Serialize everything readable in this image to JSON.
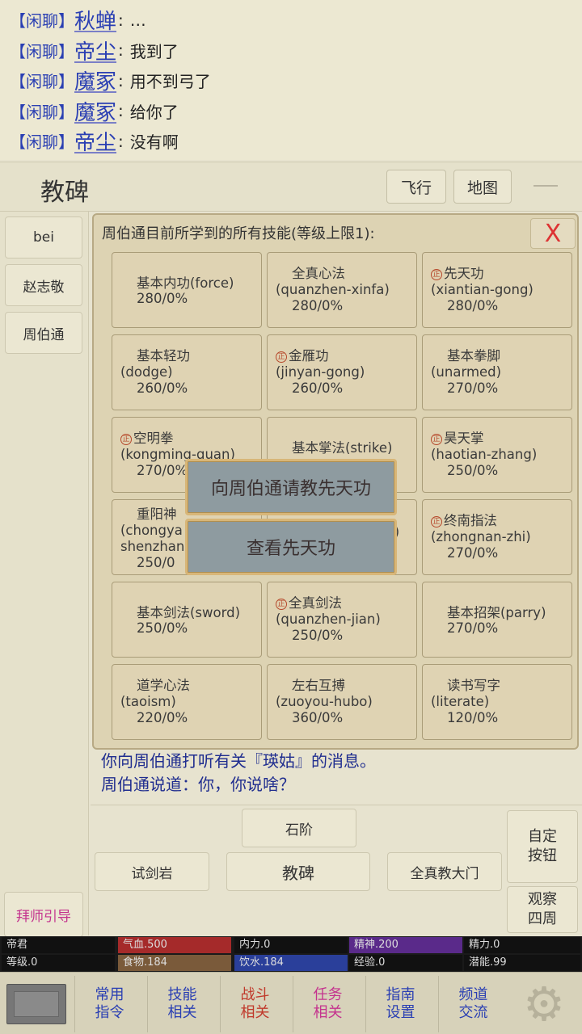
{
  "chat": {
    "lines": [
      {
        "tag": "【闲聊】",
        "name": "秋蝉",
        "colon": ":",
        "msg": "…"
      },
      {
        "tag": "【闲聊】",
        "name": "帝尘",
        "colon": ":",
        "msg": "我到了"
      },
      {
        "tag": "【闲聊】",
        "name": "魔冢",
        "colon": ":",
        "msg": "用不到弓了"
      },
      {
        "tag": "【闲聊】",
        "name": "魔冢",
        "colon": ":",
        "msg": "给你了"
      },
      {
        "tag": "【闲聊】",
        "name": "帝尘",
        "colon": ":",
        "msg": "没有啊"
      }
    ]
  },
  "location": {
    "title": "教碑",
    "fly_label": "飞行",
    "map_label": "地图"
  },
  "sidebar": {
    "npcs": [
      "bei",
      "赵志敬",
      "周伯通"
    ],
    "apprentice_label": "拜师引导"
  },
  "dialog": {
    "title": "周伯通目前所学到的所有技能(等级上限1):",
    "close_label": "X",
    "skills": [
      {
        "l1": "基本内功(force)",
        "l2": "280/0%"
      },
      {
        "l1": "全真心法",
        "l2": "(quanzhen-xinfa)",
        "l3": "280/0%"
      },
      {
        "mark": "正",
        "l1": "先天功",
        "l2": "(xiantian-gong)",
        "l3": "280/0%"
      },
      {
        "l1": "基本轻功",
        "l2": "(dodge)",
        "l3": "260/0%"
      },
      {
        "mark": "正",
        "l1": "金雁功",
        "l2": "(jinyan-gong)",
        "l3": "260/0%"
      },
      {
        "l1": "基本拳脚",
        "l2": "(unarmed)",
        "l3": "270/0%"
      },
      {
        "mark": "正",
        "l1": "空明拳",
        "l2": "(kongming-quan)",
        "l3": "270/0%"
      },
      {
        "l1": "基本掌法(strike)",
        "l2": ""
      },
      {
        "mark": "正",
        "l1": "昊天掌",
        "l2": "(haotian-zhang)",
        "l3": "250/0%"
      },
      {
        "l1": "重阳神",
        "l2": "(chongya",
        "l2b": "shenzhan",
        "l3": "250/0"
      },
      {
        "l1": "",
        "l2": "r)"
      },
      {
        "mark": "正",
        "l1": "终南指法",
        "l2": "(zhongnan-zhi)",
        "l3": "270/0%"
      },
      {
        "l1": "基本剑法(sword)",
        "l2": "250/0%"
      },
      {
        "mark": "正",
        "l1": "全真剑法",
        "l2": "(quanzhen-jian)",
        "l3": "250/0%"
      },
      {
        "l1": "基本招架(parry)",
        "l2": "270/0%"
      },
      {
        "l1": "道学心法",
        "l2": "(taoism)",
        "l3": "220/0%"
      },
      {
        "l1": "左右互搏",
        "l2": "(zuoyou-hubo)",
        "l3": "360/0%"
      },
      {
        "l1": "读书写字",
        "l2": "(literate)",
        "l3": "120/0%"
      }
    ]
  },
  "popup": {
    "ask_label": "向周伯通请教先天功",
    "view_label": "查看先天功"
  },
  "messages": [
    "你向周伯通打听有关『瑛姑』的消息。",
    "周伯通说道：你，你说啥？"
  ],
  "exits": {
    "north": "石阶",
    "west": "试剑岩",
    "center": "教碑",
    "east": "全真教大门",
    "custom_label_1": "自定",
    "custom_label_2": "按钮",
    "observe_label_1": "观察",
    "observe_label_2": "四周"
  },
  "status": {
    "name": "帝君",
    "hp": "气血.500",
    "neili": "内力.0",
    "jingshen": "精神.200",
    "jingli": "精力.0",
    "level": "等级.0",
    "food": "食物.184",
    "water": "饮水.184",
    "exp": "经验.0",
    "potential": "潜能.99",
    "colors": {
      "hp": "#a52a2a",
      "food": "#7a5a3a",
      "water": "#2a3f9a",
      "jingshen": "#5a2a8a"
    }
  },
  "nav": {
    "items": [
      {
        "l1": "常用",
        "l2": "指令",
        "color": "#2a3fb3"
      },
      {
        "l1": "技能",
        "l2": "相关",
        "color": "#2a3fb3"
      },
      {
        "l1": "战斗",
        "l2": "相关",
        "color": "#c0392b"
      },
      {
        "l1": "任务",
        "l2": "相关",
        "color": "#c4338e"
      },
      {
        "l1": "指南",
        "l2": "设置",
        "color": "#2a3fb3"
      },
      {
        "l1": "频道",
        "l2": "交流",
        "color": "#2a3fb3"
      }
    ],
    "logo_icon": "game-logo-icon",
    "gear_icon": "gear-icon"
  }
}
